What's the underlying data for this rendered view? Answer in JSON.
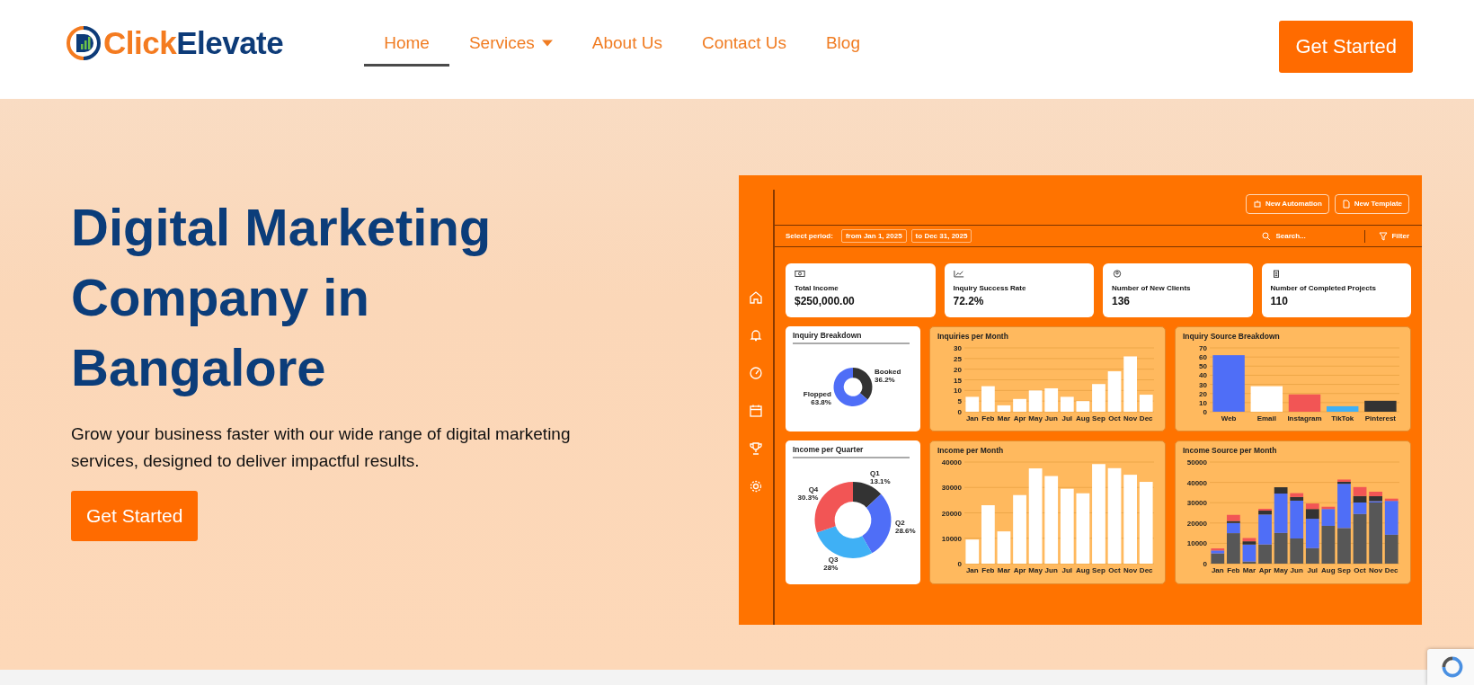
{
  "header": {
    "logo": {
      "first": "Click",
      "second": "Elevate"
    },
    "nav": [
      {
        "label": "Home",
        "selected": true,
        "dropdown": false
      },
      {
        "label": "Services",
        "selected": false,
        "dropdown": true
      },
      {
        "label": "About Us",
        "selected": false,
        "dropdown": false
      },
      {
        "label": "Contact Us",
        "selected": false,
        "dropdown": false
      },
      {
        "label": "Blog",
        "selected": false,
        "dropdown": false
      }
    ],
    "cta": "Get Started"
  },
  "hero": {
    "title": "Digital Marketing Company in Bangalore",
    "subtitle": "Grow your business faster with our wide range of digital marketing services, designed to deliver impactful results.",
    "button": "Get Started"
  },
  "dashboard": {
    "actions": [
      "New Automation",
      "New Template"
    ],
    "period_label": "Select period:",
    "from": "from Jan 1, 2025",
    "to": "to Dec 31, 2025",
    "search": {
      "placeholder": "Search..."
    },
    "filter": "Filter",
    "stats": [
      {
        "label": "Total Income",
        "value": "$250,000.00"
      },
      {
        "label": "Inquiry Success Rate",
        "value": "72.2%"
      },
      {
        "label": "Number of New Clients",
        "value": "136"
      },
      {
        "label": "Number of Completed Projects",
        "value": "110"
      }
    ],
    "charts": [
      {
        "chart_data": {
          "type": "donut",
          "title": "Inquiry Breakdown",
          "categories": [
            "Booked",
            "Flopped"
          ],
          "values": [
            36.2,
            63.8
          ],
          "colors": [
            "#333333",
            "#4f6ef7"
          ],
          "value_labels": [
            "36.2%",
            "63.8%"
          ]
        }
      },
      {
        "chart_data": {
          "type": "bar",
          "title": "Inquiries per Month",
          "categories": [
            "Jan",
            "Feb",
            "Mar",
            "Apr",
            "May",
            "Jun",
            "Jul",
            "Aug",
            "Sep",
            "Oct",
            "Nov",
            "Dec"
          ],
          "series": [
            {
              "color": "#ffffff",
              "values": [
                7,
                12,
                3,
                6,
                10,
                11,
                7,
                5,
                13,
                19,
                26,
                8
              ]
            }
          ],
          "ylim": [
            0,
            30
          ],
          "yticks": [
            0,
            5,
            10,
            15,
            20,
            25,
            30
          ],
          "grid": true
        }
      },
      {
        "chart_data": {
          "type": "bar",
          "title": "Inquiry Source Breakdown",
          "categories": [
            "Web",
            "Email",
            "Instagram",
            "TikTok",
            "Pinterest"
          ],
          "series": [
            {
              "values": [
                62,
                28,
                19,
                6,
                12
              ]
            }
          ],
          "colors": [
            "#4f6ef7",
            "#ffffff",
            "#f25555",
            "#3fb0f5",
            "#333333"
          ],
          "ylim": [
            0,
            70
          ],
          "yticks": [
            0,
            10,
            20,
            30,
            40,
            50,
            60,
            70
          ],
          "grid": true
        }
      },
      {
        "chart_data": {
          "type": "donut",
          "title": "Income per Quarter",
          "categories": [
            "Q1",
            "Q2",
            "Q3",
            "Q4"
          ],
          "values": [
            13.1,
            28.6,
            28,
            30.3
          ],
          "colors": [
            "#333333",
            "#4f6ef7",
            "#3fb0f5",
            "#f25555"
          ],
          "value_labels": [
            "13.1%",
            "28.6%",
            "28%",
            "30.3%"
          ]
        }
      },
      {
        "chart_data": {
          "type": "bar",
          "title": "Income per Month",
          "categories": [
            "Jan",
            "Feb",
            "Mar",
            "Apr",
            "May",
            "Jun",
            "Jul",
            "Aug",
            "Sep",
            "Oct",
            "Nov",
            "Dec"
          ],
          "series": [
            {
              "color": "#ffffff",
              "values": [
                9500,
                23000,
                12700,
                27000,
                37500,
                34500,
                29500,
                27700,
                39200,
                37600,
                35000,
                32200
              ]
            }
          ],
          "ylim": [
            0,
            40000
          ],
          "yticks": [
            0,
            10000,
            20000,
            30000,
            40000
          ],
          "grid": true
        }
      },
      {
        "chart_data": {
          "type": "bar",
          "title": "Income Source per Month",
          "stacked": true,
          "categories": [
            "Jan",
            "Feb",
            "Mar",
            "Apr",
            "May",
            "Jun",
            "Jul",
            "Aug",
            "Sep",
            "Oct",
            "Nov",
            "Dec"
          ],
          "series": [
            {
              "color": "#575757",
              "values": [
                5000,
                15000,
                1000,
                9400,
                15100,
                12400,
                7600,
                18600,
                17500,
                24400,
                30100,
                14200
              ]
            },
            {
              "color": "#4f6ef7",
              "values": [
                1500,
                5000,
                8400,
                14800,
                19400,
                18600,
                14500,
                8300,
                21800,
                5700,
                700,
                16700
              ]
            },
            {
              "color": "#333333",
              "values": [
                null,
                1000,
                1600,
                1900,
                3100,
                1800,
                4800,
                null,
                1000,
                3200,
                2400,
                null
              ]
            },
            {
              "color": "#f25555",
              "values": [
                1000,
                3000,
                1600,
                900,
                null,
                1900,
                2700,
                1100,
                1100,
                4400,
                2200,
                1100
              ]
            }
          ],
          "ylim": [
            0,
            50000
          ],
          "yticks": [
            0,
            10000,
            20000,
            30000,
            40000,
            50000
          ],
          "grid": true
        }
      }
    ]
  }
}
